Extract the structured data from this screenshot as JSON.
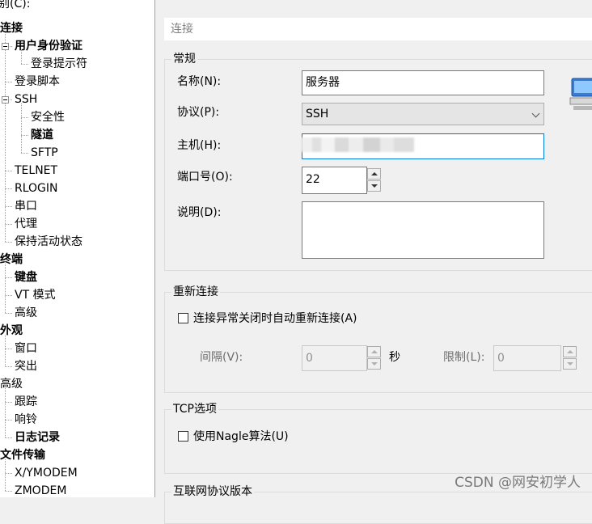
{
  "tree": {
    "top_label": "别(C):",
    "items": [
      {
        "label": "连接",
        "level": 0,
        "bold": true
      },
      {
        "label": "用户身份验证",
        "level": 1,
        "bold": true
      },
      {
        "label": "登录提示符",
        "level": 2,
        "bold": false
      },
      {
        "label": "登录脚本",
        "level": 1,
        "bold": false
      },
      {
        "label": "SSH",
        "level": 1,
        "bold": false
      },
      {
        "label": "安全性",
        "level": 2,
        "bold": false
      },
      {
        "label": "隧道",
        "level": 2,
        "bold": true
      },
      {
        "label": "SFTP",
        "level": 2,
        "bold": false
      },
      {
        "label": "TELNET",
        "level": 1,
        "bold": false
      },
      {
        "label": "RLOGIN",
        "level": 1,
        "bold": false
      },
      {
        "label": "串口",
        "level": 1,
        "bold": false
      },
      {
        "label": "代理",
        "level": 1,
        "bold": false
      },
      {
        "label": "保持活动状态",
        "level": 1,
        "bold": false
      },
      {
        "label": "终端",
        "level": 0,
        "bold": true
      },
      {
        "label": "键盘",
        "level": 1,
        "bold": true
      },
      {
        "label": "VT 模式",
        "level": 1,
        "bold": false
      },
      {
        "label": "高级",
        "level": 1,
        "bold": false
      },
      {
        "label": "外观",
        "level": 0,
        "bold": true
      },
      {
        "label": "窗口",
        "level": 1,
        "bold": false
      },
      {
        "label": "突出",
        "level": 1,
        "bold": false
      },
      {
        "label": "高级",
        "level": 0,
        "bold": false
      },
      {
        "label": "跟踪",
        "level": 1,
        "bold": false
      },
      {
        "label": "响铃",
        "level": 1,
        "bold": false
      },
      {
        "label": "日志记录",
        "level": 1,
        "bold": true
      },
      {
        "label": "文件传输",
        "level": 0,
        "bold": true
      },
      {
        "label": "X/YMODEM",
        "level": 1,
        "bold": false
      },
      {
        "label": "ZMODEM",
        "level": 1,
        "bold": false
      }
    ]
  },
  "header": "连接",
  "general": {
    "title": "常规",
    "name_label": "名称(N):",
    "name_value": "服务器",
    "protocol_label": "协议(P):",
    "protocol_value": "SSH",
    "host_label": "主机(H):",
    "host_value": "",
    "port_label": "端口号(O):",
    "port_value": "22",
    "desc_label": "说明(D):",
    "desc_value": ""
  },
  "reconnect": {
    "title": "重新连接",
    "auto_label": "连接异常关闭时自动重新连接(A)",
    "auto_checked": false,
    "interval_label": "间隔(V):",
    "interval_value": "0",
    "interval_unit": "秒",
    "limit_label": "限制(L):",
    "limit_value": "0"
  },
  "tcp": {
    "title": "TCP选项",
    "nagle_label": "使用Nagle算法(U)",
    "nagle_checked": false
  },
  "ip_version_title": "互联网协议版本",
  "watermark": "CSDN @网安初学人"
}
